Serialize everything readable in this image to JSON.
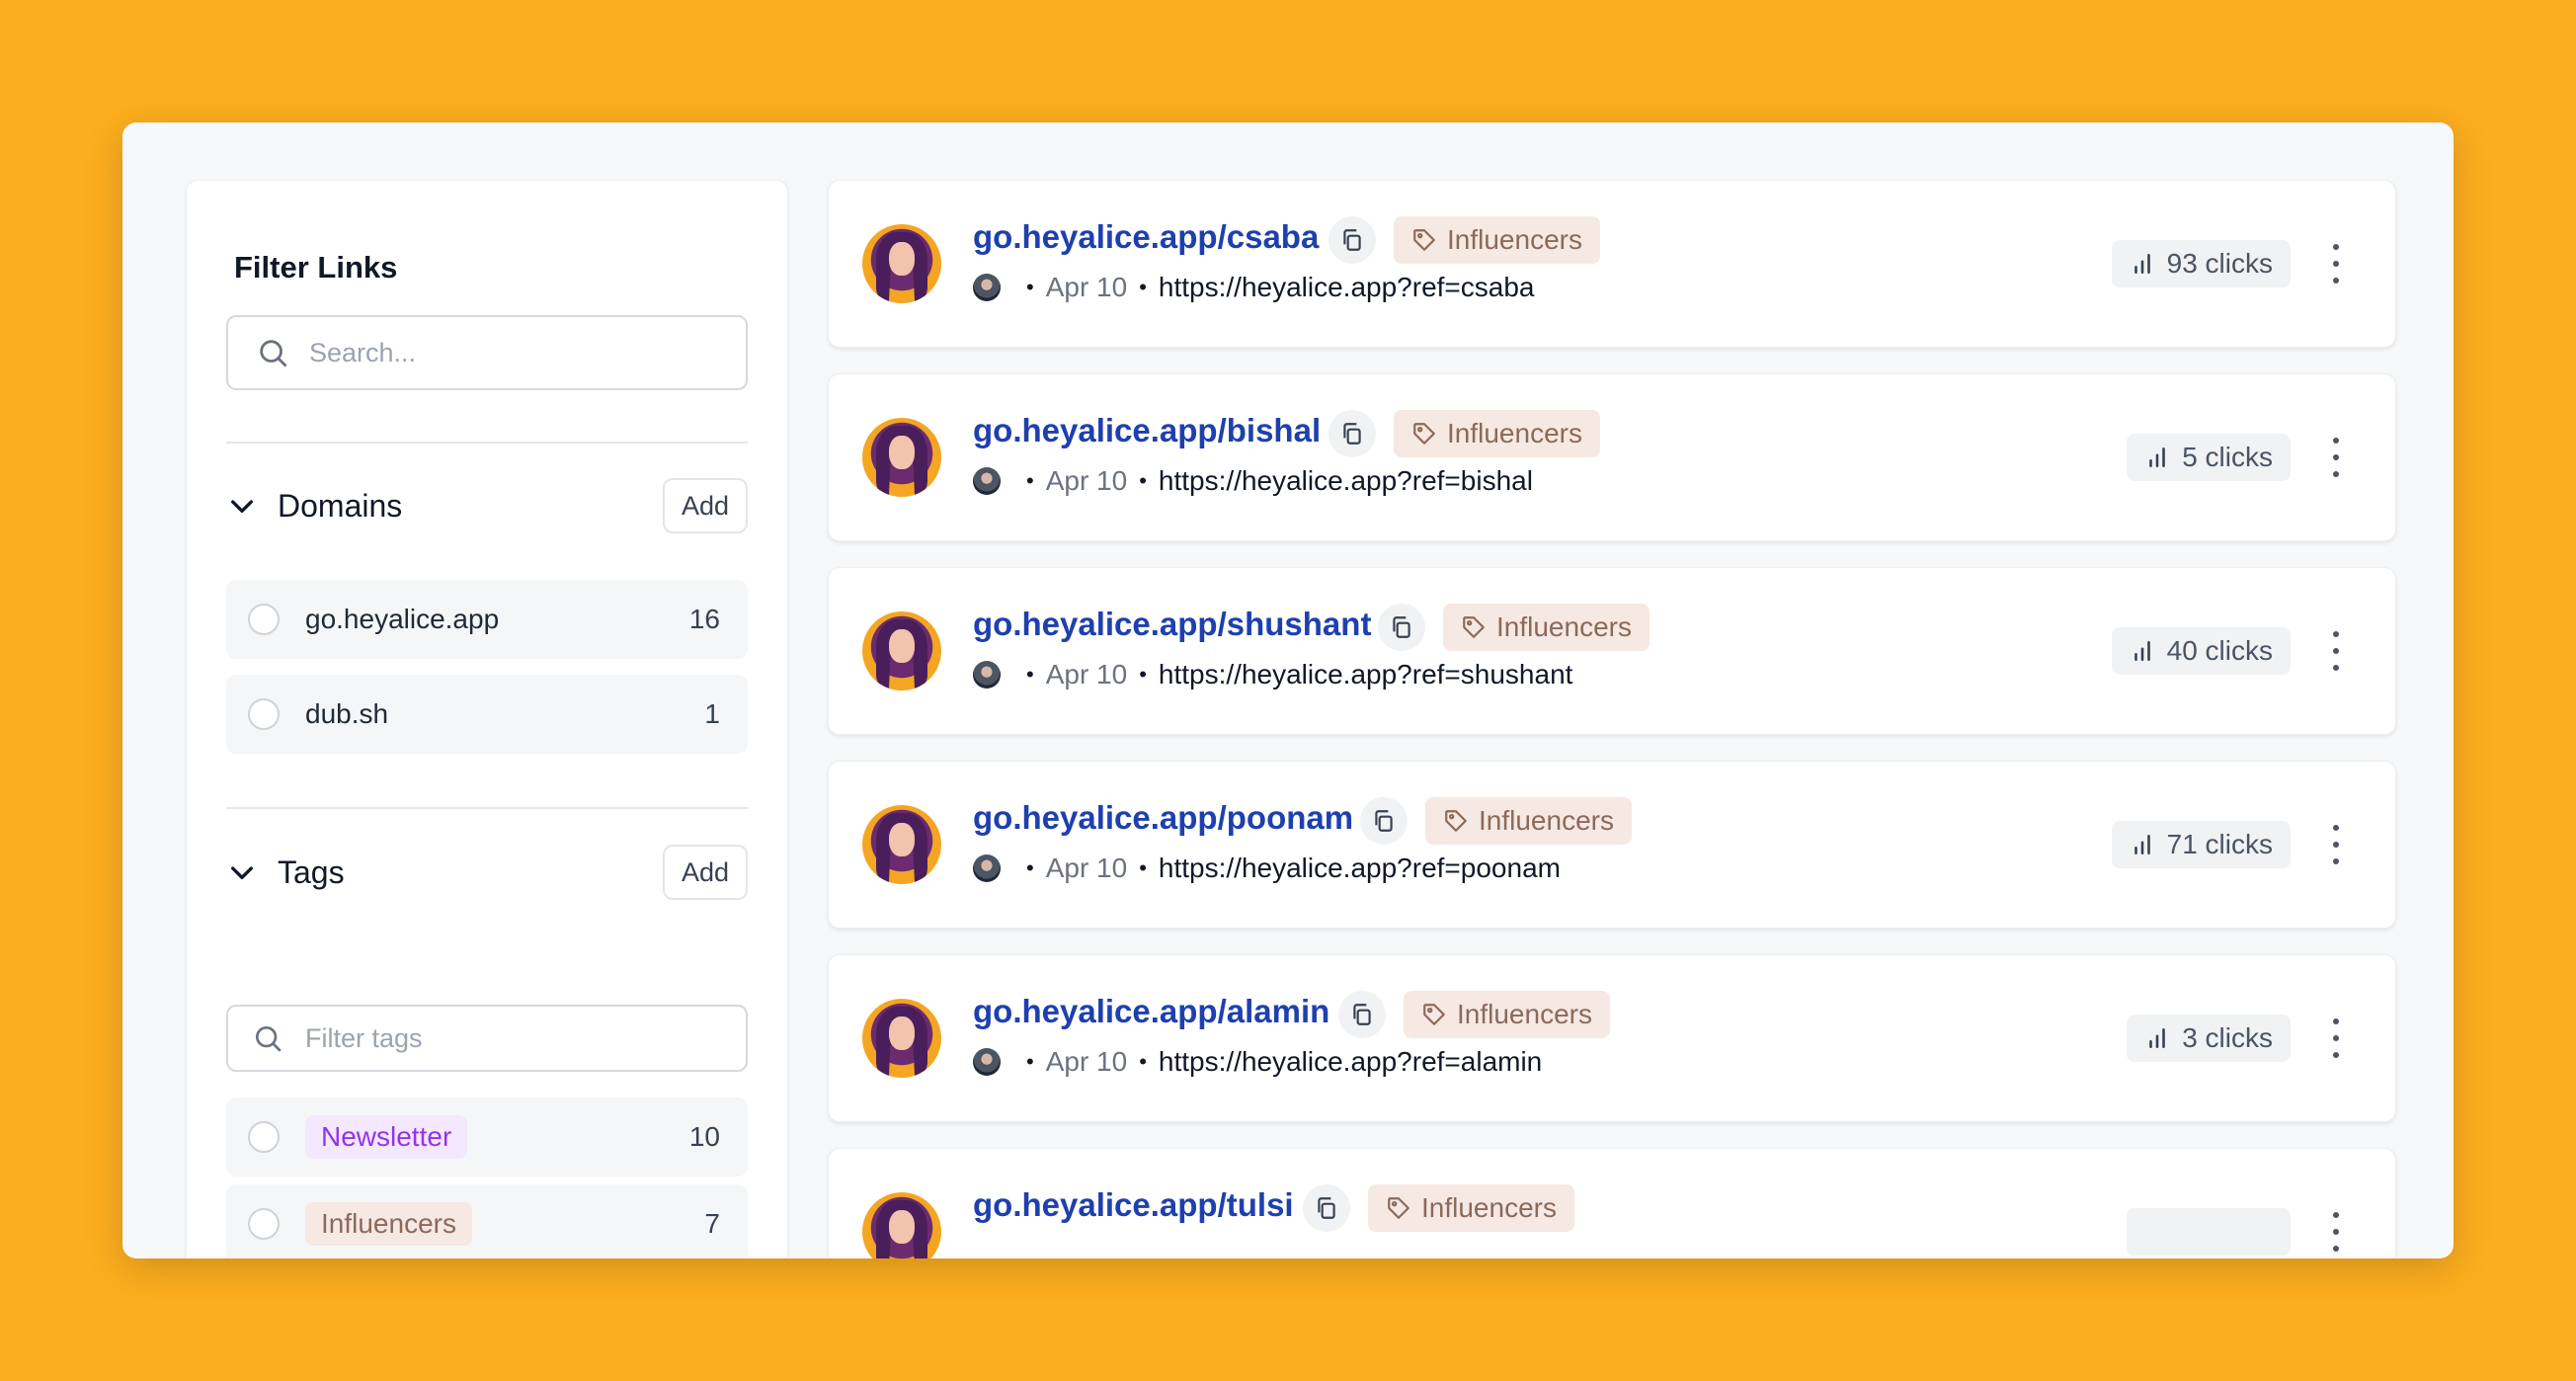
{
  "sidebar": {
    "title": "Filter Links",
    "search_placeholder": "Search...",
    "domains": {
      "label": "Domains",
      "add_label": "Add",
      "items": [
        {
          "name": "go.heyalice.app",
          "count": "16"
        },
        {
          "name": "dub.sh",
          "count": "1"
        }
      ]
    },
    "tags": {
      "label": "Tags",
      "add_label": "Add",
      "filter_placeholder": "Filter tags",
      "items": [
        {
          "name": "Newsletter",
          "count": "10",
          "color": "#9333ea"
        },
        {
          "name": "Influencers",
          "count": "7",
          "color": "#8b6a5a"
        }
      ]
    }
  },
  "links": [
    {
      "short": "go.heyalice.app/csaba",
      "tag": "Influencers",
      "date": "Apr 10",
      "dest": "https://heyalice.app?ref=csaba",
      "clicks": "93 clicks"
    },
    {
      "short": "go.heyalice.app/bishal",
      "tag": "Influencers",
      "date": "Apr 10",
      "dest": "https://heyalice.app?ref=bishal",
      "clicks": "5 clicks"
    },
    {
      "short": "go.heyalice.app/shushant",
      "tag": "Influencers",
      "date": "Apr 10",
      "dest": "https://heyalice.app?ref=shushant",
      "clicks": "40 clicks"
    },
    {
      "short": "go.heyalice.app/poonam",
      "tag": "Influencers",
      "date": "Apr 10",
      "dest": "https://heyalice.app?ref=poonam",
      "clicks": "71 clicks"
    },
    {
      "short": "go.heyalice.app/alamin",
      "tag": "Influencers",
      "date": "Apr 10",
      "dest": "https://heyalice.app?ref=alamin",
      "clicks": "3 clicks"
    },
    {
      "short": "go.heyalice.app/tulsi",
      "tag": "Influencers",
      "date": "",
      "dest": "",
      "clicks": ""
    }
  ],
  "colors": {
    "background": "#FDAE1E",
    "link": "#1e40af",
    "tag_bg": "#f6e8e2",
    "tag_text": "#8b6a5a"
  }
}
